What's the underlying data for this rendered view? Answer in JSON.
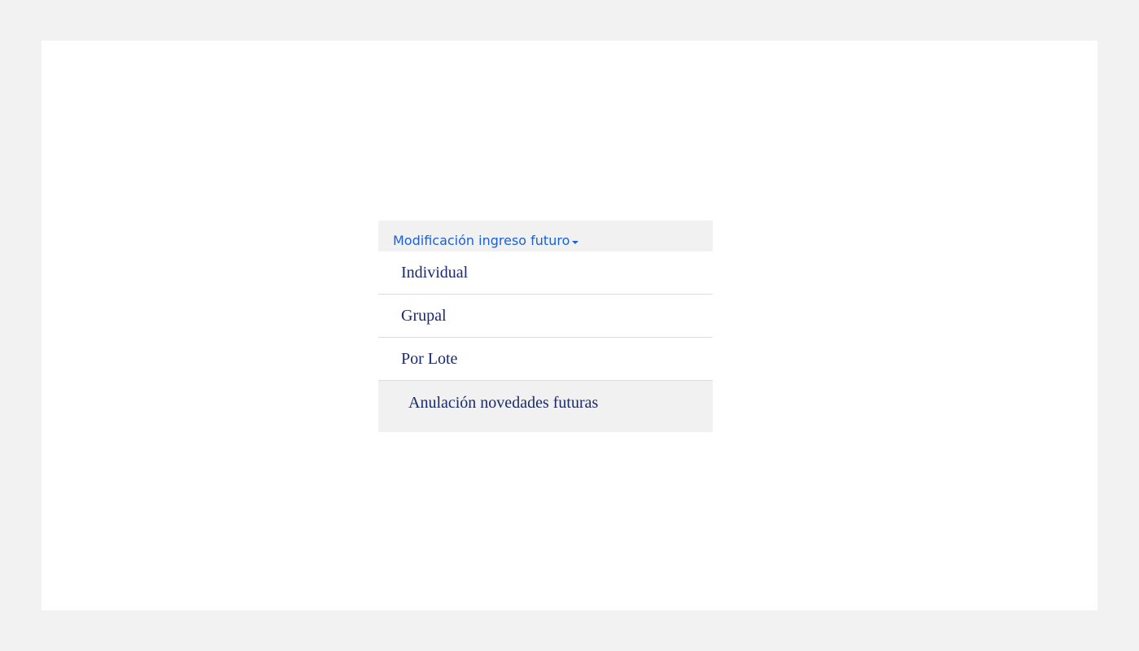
{
  "menu": {
    "header_label": "Modificación ingreso futuro",
    "header_icon": "caret-down-icon",
    "items": [
      {
        "label": "Individual"
      },
      {
        "label": "Grupal"
      },
      {
        "label": "Por Lote"
      }
    ],
    "sub_item": {
      "label": "Anulación novedades futuras"
    }
  },
  "colors": {
    "link": "#1c5fd6",
    "item_text": "#1a2a6c",
    "header_bg": "#f1f1f1",
    "page_bg": "#f2f2f2"
  }
}
